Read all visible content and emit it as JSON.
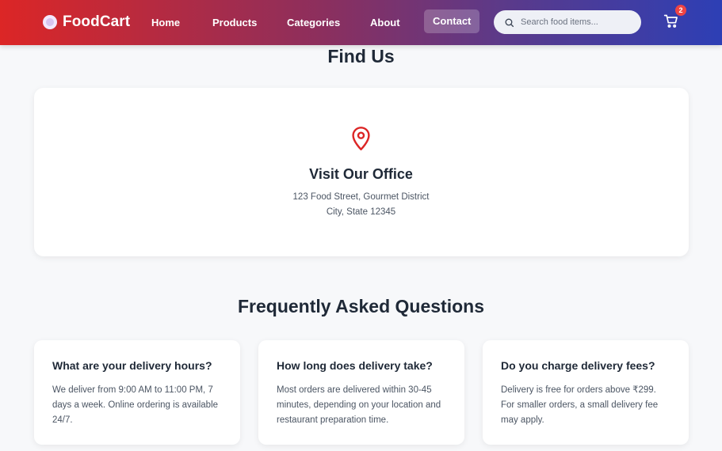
{
  "navbar": {
    "brand": "FoodCart",
    "links": [
      "Home",
      "Products",
      "Categories",
      "About",
      "Contact"
    ],
    "active_link": "Contact",
    "search_placeholder": "Search food items...",
    "cart_count": "2"
  },
  "find_us": {
    "title": "Find Us",
    "office_heading": "Visit Our Office",
    "address_line1": "123 Food Street, Gourmet District",
    "address_line2": "City, State 12345"
  },
  "faq": {
    "title": "Frequently Asked Questions",
    "items": [
      {
        "question": "What are your delivery hours?",
        "answer": "We deliver from 9:00 AM to 11:00 PM, 7 days a week. Online ordering is available 24/7."
      },
      {
        "question": "How long does delivery take?",
        "answer": "Most orders are delivered within 30-45 minutes, depending on your location and restaurant preparation time."
      },
      {
        "question": "Do you charge delivery fees?",
        "answer": "Delivery is free for orders above ₹299. For smaller orders, a small delivery fee may apply."
      }
    ]
  },
  "colors": {
    "accent_red": "#dc2626",
    "gradient_end": "#2d3fb5",
    "badge": "#ef4444"
  },
  "icons": {
    "brand": "plate-icon",
    "search": "search-icon",
    "cart": "cart-icon",
    "location": "map-pin-icon"
  }
}
